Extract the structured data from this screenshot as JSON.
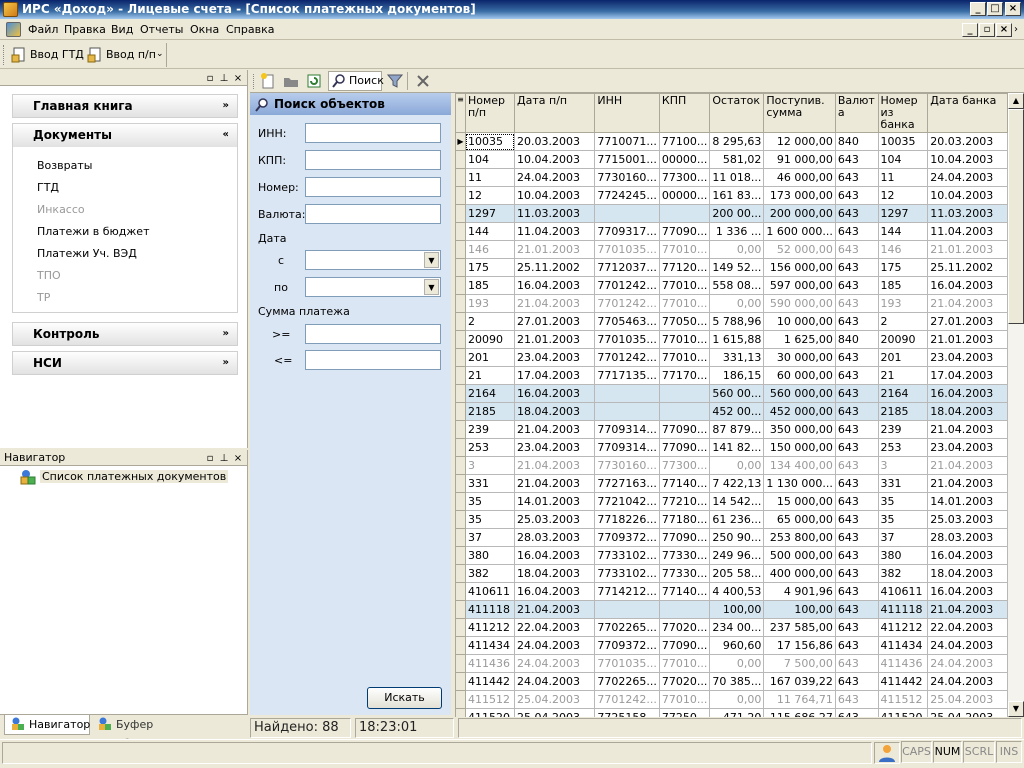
{
  "window": {
    "title": "ИРС «Доход» - Лицевые счета - [Список платежных документов]"
  },
  "menu": [
    {
      "label": "Файл"
    },
    {
      "label": "Правка"
    },
    {
      "label": "Вид"
    },
    {
      "label": "Отчеты"
    },
    {
      "label": "Окна"
    },
    {
      "label": "Справка"
    }
  ],
  "toolbar": {
    "btn1": "Ввод ГТД",
    "btn2": "Ввод п/п"
  },
  "sections": {
    "main_book": "Главная книга",
    "documents": "Документы",
    "control": "Контроль",
    "nsi": "НСИ"
  },
  "doc_items": [
    "Возвраты",
    "ГТД",
    "Инкассо",
    "Платежи в бюджет",
    "Платежи Уч. ВЭД",
    "ТПО",
    "ТР"
  ],
  "navigator": {
    "title": "Навигатор",
    "item": "Список платежных документов"
  },
  "bottom_tabs": {
    "nav": "Навигатор",
    "buffer": "Буфер объектов"
  },
  "doc_toolbar": {
    "search": "Поиск"
  },
  "search": {
    "title": "Поиск объектов",
    "inn": "ИНН:",
    "kpp": "КПП:",
    "number": "Номер:",
    "currency": "Валюта:",
    "date": "Дата",
    "from": "с",
    "to": "по",
    "sum": "Сумма платежа",
    "gte": ">=",
    "lte": "<=",
    "button": "Искать"
  },
  "grid": {
    "columns": [
      "Номер п/п",
      "Дата п/п",
      "ИНН",
      "КПП",
      "Остаток",
      "Поступив. сумма",
      "Валют а",
      "Номер из банка",
      "Дата банка"
    ],
    "rows": [
      [
        "10035",
        "20.03.2003",
        "7710071...",
        "77100...",
        "8 295,63",
        "12 000,00",
        "840",
        "10035",
        "20.03.2003"
      ],
      [
        "104",
        "10.04.2003",
        "7715001...",
        "00000...",
        "581,02",
        "91 000,00",
        "643",
        "104",
        "10.04.2003"
      ],
      [
        "11",
        "24.04.2003",
        "7730160...",
        "77300...",
        "11 018...",
        "46 000,00",
        "643",
        "11",
        "24.04.2003"
      ],
      [
        "12",
        "10.04.2003",
        "7724245...",
        "00000...",
        "161 83...",
        "173 000,00",
        "643",
        "12",
        "10.04.2003"
      ],
      [
        "1297",
        "11.03.2003",
        "",
        "",
        "200 00...",
        "200 000,00",
        "643",
        "1297",
        "11.03.2003"
      ],
      [
        "144",
        "11.04.2003",
        "7709317...",
        "77090...",
        "1 336 ...",
        "1 600 000...",
        "643",
        "144",
        "11.04.2003"
      ],
      [
        "146",
        "21.01.2003",
        "7701035...",
        "77010...",
        "0,00",
        "52 000,00",
        "643",
        "146",
        "21.01.2003"
      ],
      [
        "175",
        "25.11.2002",
        "7712037...",
        "77120...",
        "149 52...",
        "156 000,00",
        "643",
        "175",
        "25.11.2002"
      ],
      [
        "185",
        "16.04.2003",
        "7701242...",
        "77010...",
        "558 08...",
        "597 000,00",
        "643",
        "185",
        "16.04.2003"
      ],
      [
        "193",
        "21.04.2003",
        "7701242...",
        "77010...",
        "0,00",
        "590 000,00",
        "643",
        "193",
        "21.04.2003"
      ],
      [
        "2",
        "27.01.2003",
        "7705463...",
        "77050...",
        "5 788,96",
        "10 000,00",
        "643",
        "2",
        "27.01.2003"
      ],
      [
        "20090",
        "21.01.2003",
        "7701035...",
        "77010...",
        "1 615,88",
        "1 625,00",
        "840",
        "20090",
        "21.01.2003"
      ],
      [
        "201",
        "23.04.2003",
        "7701242...",
        "77010...",
        "331,13",
        "30 000,00",
        "643",
        "201",
        "23.04.2003"
      ],
      [
        "21",
        "17.04.2003",
        "7717135...",
        "77170...",
        "186,15",
        "60 000,00",
        "643",
        "21",
        "17.04.2003"
      ],
      [
        "2164",
        "16.04.2003",
        "",
        "",
        "560 00...",
        "560 000,00",
        "643",
        "2164",
        "16.04.2003"
      ],
      [
        "2185",
        "18.04.2003",
        "",
        "",
        "452 00...",
        "452 000,00",
        "643",
        "2185",
        "18.04.2003"
      ],
      [
        "239",
        "21.04.2003",
        "7709314...",
        "77090...",
        "87 879...",
        "350 000,00",
        "643",
        "239",
        "21.04.2003"
      ],
      [
        "253",
        "23.04.2003",
        "7709314...",
        "77090...",
        "141 82...",
        "150 000,00",
        "643",
        "253",
        "23.04.2003"
      ],
      [
        "3",
        "21.04.2003",
        "7730160...",
        "77300...",
        "0,00",
        "134 400,00",
        "643",
        "3",
        "21.04.2003"
      ],
      [
        "331",
        "21.04.2003",
        "7727163...",
        "77140...",
        "7 422,13",
        "1 130 000...",
        "643",
        "331",
        "21.04.2003"
      ],
      [
        "35",
        "14.01.2003",
        "7721042...",
        "77210...",
        "14 542...",
        "15 000,00",
        "643",
        "35",
        "14.01.2003"
      ],
      [
        "35",
        "25.03.2003",
        "7718226...",
        "77180...",
        "61 236...",
        "65 000,00",
        "643",
        "35",
        "25.03.2003"
      ],
      [
        "37",
        "28.03.2003",
        "7709372...",
        "77090...",
        "250 90...",
        "253 800,00",
        "643",
        "37",
        "28.03.2003"
      ],
      [
        "380",
        "16.04.2003",
        "7733102...",
        "77330...",
        "249 96...",
        "500 000,00",
        "643",
        "380",
        "16.04.2003"
      ],
      [
        "382",
        "18.04.2003",
        "7733102...",
        "77330...",
        "205 58...",
        "400 000,00",
        "643",
        "382",
        "18.04.2003"
      ],
      [
        "410611",
        "16.04.2003",
        "7714212...",
        "77140...",
        "4 400,53",
        "4 901,96",
        "643",
        "410611",
        "16.04.2003"
      ],
      [
        "411118",
        "21.04.2003",
        "",
        "",
        "100,00",
        "100,00",
        "643",
        "411118",
        "21.04.2003"
      ],
      [
        "411212",
        "22.04.2003",
        "7702265...",
        "77020...",
        "234 00...",
        "237 585,00",
        "643",
        "411212",
        "22.04.2003"
      ],
      [
        "411434",
        "24.04.2003",
        "7709372...",
        "77090...",
        "960,60",
        "17 156,86",
        "643",
        "411434",
        "24.04.2003"
      ],
      [
        "411436",
        "24.04.2003",
        "7701035...",
        "77010...",
        "0,00",
        "7 500,00",
        "643",
        "411436",
        "24.04.2003"
      ],
      [
        "411442",
        "24.04.2003",
        "7702265...",
        "77020...",
        "70 385...",
        "167 039,22",
        "643",
        "411442",
        "24.04.2003"
      ],
      [
        "411512",
        "25.04.2003",
        "7701242...",
        "77010...",
        "0,00",
        "11 764,71",
        "643",
        "411512",
        "25.04.2003"
      ],
      [
        "411520",
        "25.04.2003",
        "7725158...",
        "77250...",
        "471,20",
        "115 686,27",
        "643",
        "411520",
        "25.04.2003"
      ]
    ],
    "row_styles": [
      "",
      "",
      "",
      "",
      "hl",
      "",
      "gray",
      "",
      "",
      "gray",
      "",
      "",
      "",
      "",
      "hl",
      "hl",
      "",
      "",
      "gray",
      "",
      "",
      "",
      "",
      "",
      "",
      "",
      "hl",
      "",
      "",
      "gray",
      "",
      "gray",
      ""
    ]
  },
  "status": {
    "found": "Найдено: 88",
    "time": "18:23:01"
  },
  "indicators": [
    "CAPS",
    "NUM",
    "SCRL",
    "INS"
  ]
}
